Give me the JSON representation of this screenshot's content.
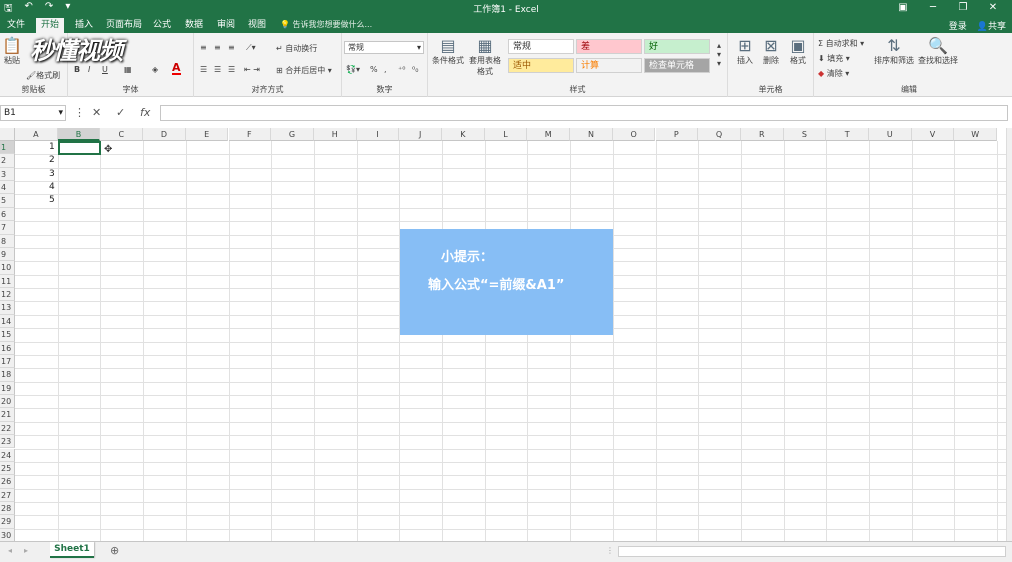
{
  "window": {
    "title": "工作簿1 - Excel"
  },
  "tabs": [
    {
      "label": "文件",
      "active": false
    },
    {
      "label": "开始",
      "active": true
    },
    {
      "label": "插入",
      "active": false
    },
    {
      "label": "页面布局",
      "active": false
    },
    {
      "label": "公式",
      "active": false
    },
    {
      "label": "数据",
      "active": false
    },
    {
      "label": "审阅",
      "active": false
    },
    {
      "label": "视图",
      "active": false
    }
  ],
  "tellme": "告诉我您想要做什么...",
  "account": {
    "login": "登录",
    "share": "共享"
  },
  "ribbon": {
    "clipboard": {
      "label": "剪贴板",
      "paste": "粘贴",
      "format_painter": "格式刷"
    },
    "font": {
      "label": "字体",
      "bold": "B",
      "italic": "I",
      "underline": "U",
      "color_a": "A"
    },
    "alignment": {
      "label": "对齐方式",
      "wrap": "自动换行",
      "merge": "合并后居中"
    },
    "number": {
      "label": "数字",
      "format_value": "常规",
      "percent": "%"
    },
    "styles": {
      "label": "样式",
      "conditional": "条件格式",
      "table_format": "套用表格格式",
      "cells": [
        {
          "name": "常规",
          "bg": "#ffffff",
          "fg": "#333333"
        },
        {
          "name": "差",
          "bg": "#ffc7ce",
          "fg": "#9c0006"
        },
        {
          "name": "好",
          "bg": "#c6efce",
          "fg": "#006100"
        },
        {
          "name": "适中",
          "bg": "#ffeb9c",
          "fg": "#9c5700"
        },
        {
          "name": "计算",
          "bg": "#f2f2f2",
          "fg": "#fa7d00"
        },
        {
          "name": "检查单元格",
          "bg": "#a5a5a5",
          "fg": "#ffffff"
        }
      ]
    },
    "cells": {
      "label": "单元格",
      "insert": "插入",
      "delete": "删除",
      "format": "格式"
    },
    "editing": {
      "label": "编辑",
      "autosum": "自动求和",
      "fill": "填充",
      "clear": "清除",
      "sort": "排序和筛选",
      "find": "查找和选择"
    }
  },
  "formula_bar": {
    "name_box": "B1",
    "fx": "fx",
    "content": ""
  },
  "columns": [
    "A",
    "B",
    "C",
    "D",
    "E",
    "F",
    "G",
    "H",
    "I",
    "J",
    "K",
    "L",
    "M",
    "N",
    "O",
    "P",
    "Q",
    "R",
    "S",
    "T",
    "U",
    "V",
    "W"
  ],
  "rows": [
    "1",
    "2",
    "3",
    "4",
    "5",
    "6",
    "7",
    "8",
    "9",
    "10",
    "11",
    "12",
    "13",
    "14",
    "15",
    "16",
    "17",
    "18",
    "19",
    "20",
    "21",
    "22",
    "23",
    "24",
    "25",
    "26",
    "27",
    "28",
    "29",
    "30"
  ],
  "cells_data": [
    {
      "ref": "A1",
      "value": "1"
    },
    {
      "ref": "A2",
      "value": "2"
    },
    {
      "ref": "A3",
      "value": "3"
    },
    {
      "ref": "A4",
      "value": "4"
    },
    {
      "ref": "A5",
      "value": "5"
    }
  ],
  "active_cell": "B1",
  "tip": {
    "title": "小提示：",
    "text": "输入公式“=前缀&A1”"
  },
  "sheet_tabs": [
    {
      "label": "Sheet1",
      "active": true
    }
  ],
  "watermark": "秒懂视频",
  "colors": {
    "accent": "#217346",
    "tip_bg": "#87bef5"
  }
}
